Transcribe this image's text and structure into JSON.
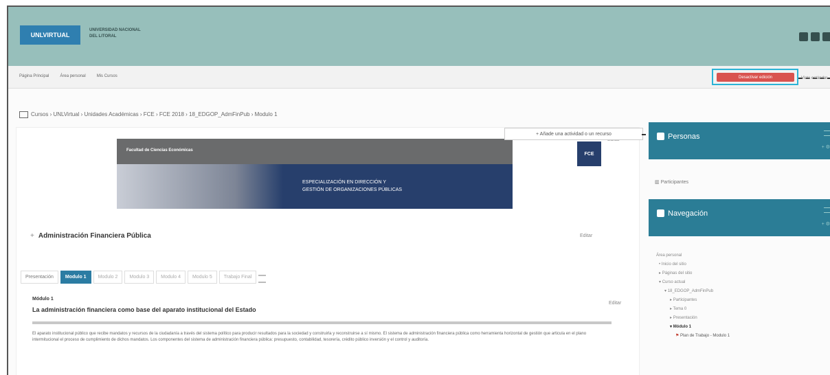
{
  "header": {
    "logo_text": "UNLVIRTUAL",
    "university_line1": "UNIVERSIDAD NACIONAL",
    "university_line2": "DEL LITORAL"
  },
  "navbar": {
    "links": [
      "Página Principal",
      "Área personal",
      "Mis Cursos"
    ],
    "edit_button": "Desactivar edición",
    "vista": "Vista estándar"
  },
  "breadcrumb": "Cursos › UNLVirtual › Unidades Académicas › FCE › FCE 2018 › 18_EDGOP_AdmFinPub › Modulo 1",
  "main": {
    "edit_label": "Editar",
    "banner_top": "Facultad de Ciencias Económicas",
    "banner_badge": "FCE",
    "banner_line1": "ESPECIALIZACIÓN EN DIRECCIÓN Y",
    "banner_line2": "GESTIÓN DE ORGANIZACIONES PÚBLICAS",
    "course_title": "Administración Financiera Pública",
    "add_activity": "+ Añade una actividad o un recurso",
    "tabs": [
      "Presentación",
      "Modulo 1",
      "Modulo 2",
      "Modulo 3",
      "Modulo 4",
      "Modulo 5",
      "Trabajo Final"
    ],
    "module_small": "Módulo 1",
    "module_title": "La administración financiera como base del aparato institucional del Estado",
    "body_text": "El aparato institucional público que recibe mandatos y recursos de la ciudadanía a través del sistema político para producir resultados para la sociedad y construirla y reconstruirse a sí mismo. El sistema de administración financiera pública como herramienta horizontal de gestión que articula en el plano intermitucional el proceso de cumplimiento de dichos mandatos. Los componentes del sistema de administración financiera pública: presupuesto, contabilidad, tesorería, crédito público inversión y el control y auditoría."
  },
  "sidebar": {
    "people_title": "Personas",
    "participants": "Participantes",
    "nav_title": "Navegación",
    "nav_items": [
      "Área personal",
      "Inicio del sitio",
      "Páginas del sitio",
      "Curso actual",
      "18_EDGOP_AdmFinPub",
      "Participantes",
      "Tema 0",
      "Presentación",
      "Módulo 1",
      "Plan de Trabajo - Modulo 1"
    ]
  }
}
